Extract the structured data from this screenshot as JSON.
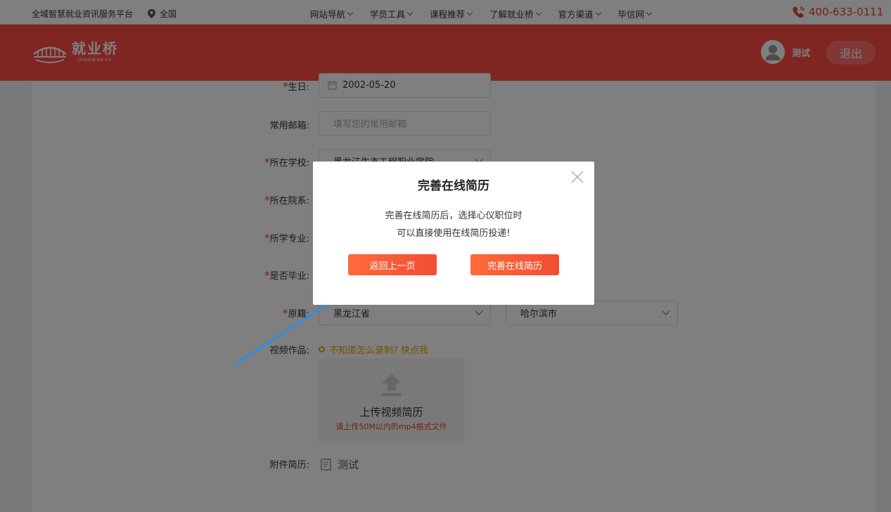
{
  "topbar": {
    "slogan": "全域智慧就业资讯服务平台",
    "location": "全国",
    "location_icon": "map-pin-icon",
    "nav": [
      "网站导航",
      "学员工具",
      "课程推荐",
      "了解就业桥",
      "官方渠道",
      "毕信网"
    ],
    "phone": "400-633-0111",
    "phone_icon": "phone-icon"
  },
  "header": {
    "logo_text": "就业桥",
    "logo_sub": "jiuyeqiao.cn",
    "username": "测试",
    "logout": "退出",
    "bg_color": "#ff4a44"
  },
  "form": {
    "birthday_label": "生日:",
    "birthday_value": "2002-05-20",
    "email_label": "常用邮箱:",
    "email_placeholder": "填写您的常用邮箱",
    "school_label": "所在学校:",
    "school_value": "黑龙江生态工程职业学院",
    "college_label": "所在院系:",
    "major_label": "所学专业:",
    "graduated_label": "是否毕业:",
    "origin_label": "原籍:",
    "origin_province": "黑龙江省",
    "origin_city": "哈尔滨市",
    "video_label": "视频作品:",
    "video_tip": "不知道怎么录制? 快点我",
    "upload_title": "上传视频简历",
    "upload_sub": "请上传50M以内的mp4格式文件",
    "attach_label": "附件简历:",
    "attach_value": "测试",
    "required_mark": "*"
  },
  "modal": {
    "title": "完善在线简历",
    "message_line1": "完善在线简历后，选择心仪职位时",
    "message_line2": "可以直接使用在线简历投递!",
    "back_button": "返回上一页",
    "complete_button": "完善在线简历",
    "accent": "#f24d33"
  }
}
